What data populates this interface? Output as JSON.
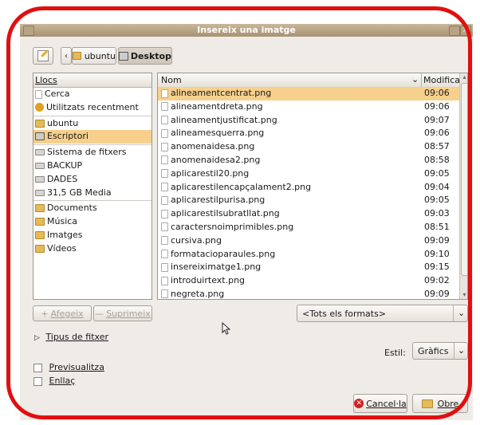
{
  "window": {
    "title": "Insereix una imatge"
  },
  "pathbar": {
    "segments": [
      "ubuntu",
      "Desktop"
    ]
  },
  "places": {
    "header": "Llocs",
    "items": [
      {
        "label": "Cerca",
        "icon": "search-icon"
      },
      {
        "label": "Utilitzats recentment",
        "icon": "recent-icon"
      },
      {
        "label": "ubuntu",
        "icon": "home-folder-icon"
      },
      {
        "label": "Escriptori",
        "icon": "desktop-icon",
        "selected": true
      },
      {
        "label": "Sistema de fitxers",
        "icon": "drive-icon"
      },
      {
        "label": "BACKUP",
        "icon": "drive-icon"
      },
      {
        "label": "DADES",
        "icon": "drive-icon"
      },
      {
        "label": "31,5 GB Media",
        "icon": "drive-icon"
      },
      {
        "label": "Documents",
        "icon": "folder-icon"
      },
      {
        "label": "Música",
        "icon": "folder-icon"
      },
      {
        "label": "Imatges",
        "icon": "folder-icon"
      },
      {
        "label": "Vídeos",
        "icon": "folder-icon"
      }
    ]
  },
  "files": {
    "col_name": "Nom",
    "col_modified": "Modificat",
    "rows": [
      {
        "name": "alineamentcentrat.png",
        "time": "09:06",
        "selected": true
      },
      {
        "name": "alineamentdreta.png",
        "time": "09:06"
      },
      {
        "name": "alineamentjustificat.png",
        "time": "09:07"
      },
      {
        "name": "alineamesquerra.png",
        "time": "09:06"
      },
      {
        "name": "anomenaidesa.png",
        "time": "08:57"
      },
      {
        "name": "anomenaidesa2.png",
        "time": "08:58"
      },
      {
        "name": "aplicarestil20.png",
        "time": "09:05"
      },
      {
        "name": "aplicarestilencapçalament2.png",
        "time": "09:04"
      },
      {
        "name": "aplicarestilpurisa.png",
        "time": "09:05"
      },
      {
        "name": "aplicarestilsubratllat.png",
        "time": "09:03"
      },
      {
        "name": "caractersnoimprimibles.png",
        "time": "08:51"
      },
      {
        "name": "cursiva.png",
        "time": "09:09"
      },
      {
        "name": "formatacioparaules.png",
        "time": "09:10"
      },
      {
        "name": "insereiximatge1.png",
        "time": "09:15"
      },
      {
        "name": "introduirtext.png",
        "time": "09:02"
      },
      {
        "name": "negreta.png",
        "time": "09:09"
      }
    ]
  },
  "buttons": {
    "add": "Afegeix",
    "remove": "Suprimeix",
    "cancel": "Cancel·la",
    "open": "Obre"
  },
  "filter": {
    "selected": "<Tots els formats>"
  },
  "file_type": {
    "label": "Tipus de fitxer"
  },
  "style": {
    "label": "Estil:",
    "selected": "Gràfics"
  },
  "options": {
    "preview": "Previsualitza",
    "link": "Enllaç"
  },
  "colors": {
    "selection": "#f6d08c",
    "titlebar": "#b4a07f",
    "highlight_outline": "#e01010"
  }
}
